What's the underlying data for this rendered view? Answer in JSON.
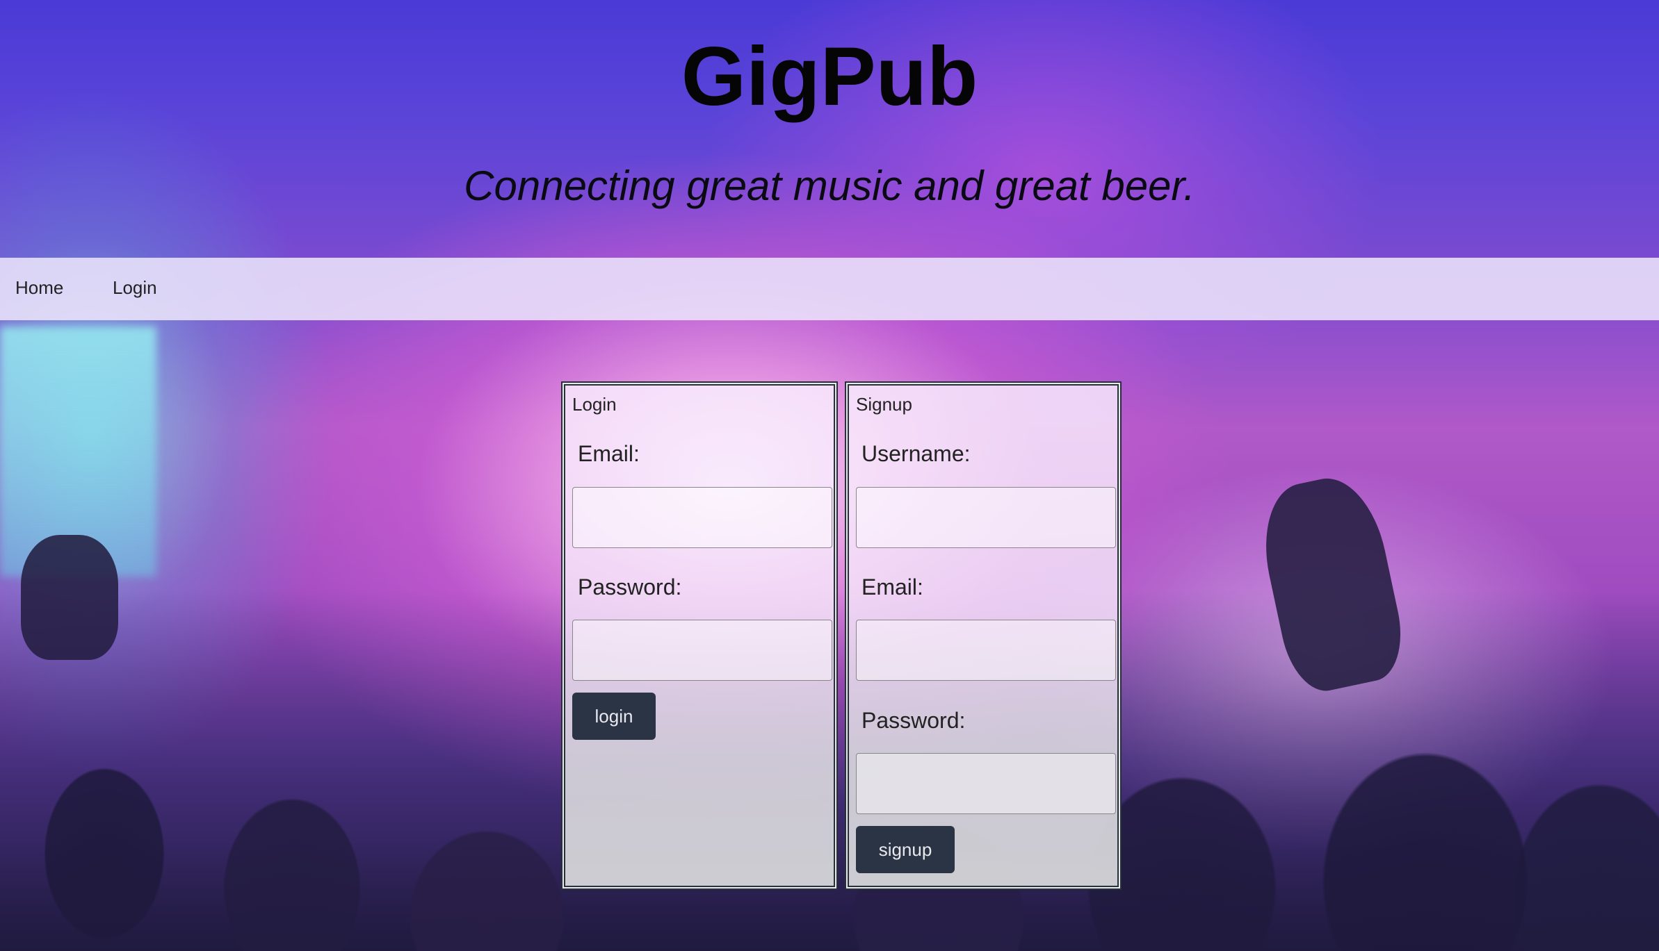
{
  "header": {
    "title": "GigPub",
    "tagline": "Connecting great music and great beer."
  },
  "nav": {
    "items": [
      {
        "label": "Home"
      },
      {
        "label": "Login"
      }
    ]
  },
  "login_panel": {
    "title": "Login",
    "email_label": "Email:",
    "email_value": "",
    "password_label": "Password:",
    "password_value": "",
    "submit_label": "login"
  },
  "signup_panel": {
    "title": "Signup",
    "username_label": "Username:",
    "username_value": "",
    "email_label": "Email:",
    "email_value": "",
    "password_label": "Password:",
    "password_value": "",
    "submit_label": "signup"
  },
  "colors": {
    "header_bg": "#4b3ad6",
    "nav_bg": "#ebe4fa",
    "button_bg": "#2b3444",
    "panel_border": "#263238"
  }
}
